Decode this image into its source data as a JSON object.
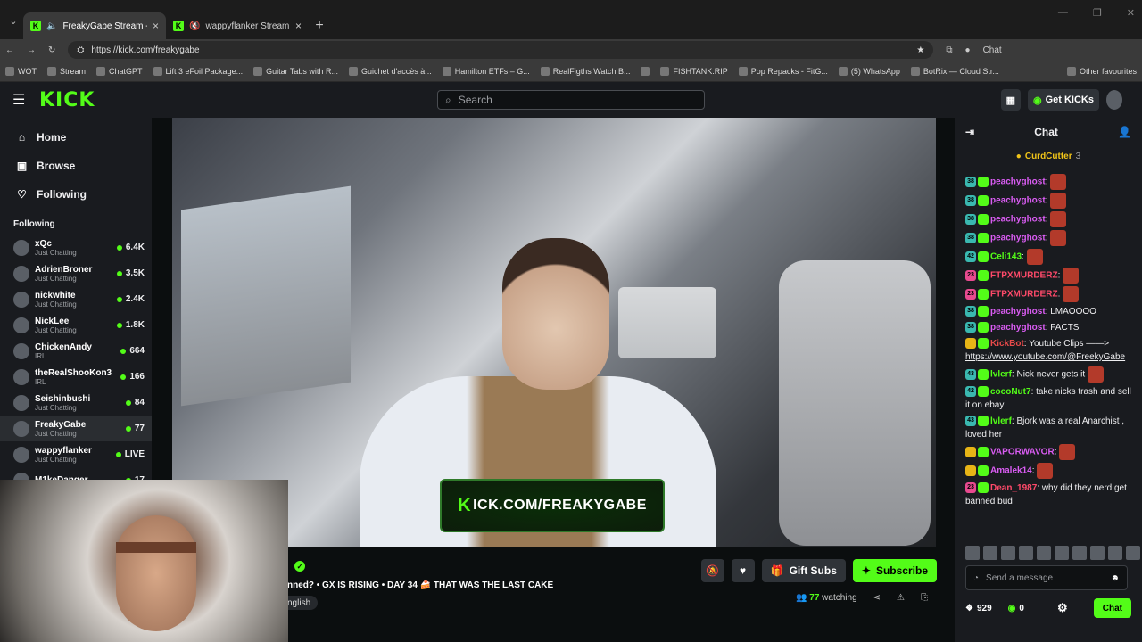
{
  "browser": {
    "tabs": [
      {
        "title": "FreakyGabe Stream - Watch L",
        "active": true
      },
      {
        "title": "wappyflanker Stream - Watc",
        "active": false
      }
    ],
    "new_tab": "+",
    "url": "https://kick.com/freakygabe",
    "chat_label": "Chat"
  },
  "bookmarks": [
    "WOT",
    "Stream",
    "ChatGPT",
    "Lift 3 eFoil Package...",
    "Guitar Tabs with R...",
    "Guichet d'accès à...",
    "Hamilton ETFs – G...",
    "RealFigths Watch B...",
    "FISHTANK.RIP",
    "Pop Repacks - FitG...",
    "(5) WhatsApp",
    "BotRix — Cloud Str...",
    "Other favourites"
  ],
  "header": {
    "logo": "KICK",
    "search_placeholder": "Search",
    "get_kicks": "Get KICKs"
  },
  "sidebar": {
    "nav": [
      {
        "label": "Home",
        "icon": "home-icon"
      },
      {
        "label": "Browse",
        "icon": "browse-icon"
      },
      {
        "label": "Following",
        "icon": "heart-icon"
      }
    ],
    "section_title": "Following",
    "channels": [
      {
        "name": "xQc",
        "desc": "Just Chatting",
        "count": "6.4K"
      },
      {
        "name": "AdrienBroner",
        "desc": "Just Chatting",
        "count": "3.5K"
      },
      {
        "name": "nickwhite",
        "desc": "Just Chatting",
        "count": "2.4K"
      },
      {
        "name": "NickLee",
        "desc": "Just Chatting",
        "count": "1.8K"
      },
      {
        "name": "ChickenAndy",
        "desc": "IRL",
        "count": "664"
      },
      {
        "name": "theRealShooKon3",
        "desc": "IRL",
        "count": "166"
      },
      {
        "name": "Seishinbushi",
        "desc": "Just Chatting",
        "count": "84"
      },
      {
        "name": "FreakyGabe",
        "desc": "Just Chatting",
        "count": "77"
      },
      {
        "name": "wappyflanker",
        "desc": "Just Chatting",
        "count": "LIVE"
      },
      {
        "name": "M1keDanger",
        "desc": "",
        "count": "17"
      }
    ]
  },
  "stream": {
    "watermark": "ICK.COM/FREAKYGABE",
    "watermark_k": "K",
    "title": "nned? • GX IS RISING • DAY 34 🍰 THAT WAS THE LAST CAKE",
    "language": "nglish",
    "gift_subs": "Gift Subs",
    "subscribe": "Subscribe",
    "watching_count": "77",
    "watching_label": "watching"
  },
  "chat": {
    "title": "Chat",
    "pinned_user": "CurdCutter",
    "pinned_count": "3",
    "messages": [
      {
        "badge": "38",
        "user": "peachyghost",
        "color": "#d95cf2",
        "text": "",
        "emote": true
      },
      {
        "badge": "38",
        "user": "peachyghost",
        "color": "#d95cf2",
        "text": "",
        "emote": true
      },
      {
        "badge": "38",
        "user": "peachyghost",
        "color": "#d95cf2",
        "text": "",
        "emote": true
      },
      {
        "badge": "38",
        "user": "peachyghost",
        "color": "#d95cf2",
        "text": "",
        "emote": true
      },
      {
        "badge": "42",
        "user": "Celi143",
        "color": "#53fc18",
        "text": "",
        "emote": true
      },
      {
        "badge": "23",
        "user": "FTPXMURDERZ",
        "color": "#ff4a6a",
        "text": "",
        "emote": true
      },
      {
        "badge": "23",
        "user": "FTPXMURDERZ",
        "color": "#ff4a6a",
        "text": "",
        "emote": true
      },
      {
        "badge": "38",
        "user": "peachyghost",
        "color": "#d95cf2",
        "text": "LMAOOOO",
        "emote": false
      },
      {
        "badge": "38",
        "user": "peachyghost",
        "color": "#d95cf2",
        "text": "FACTS",
        "emote": false
      },
      {
        "badge": "",
        "user": "KickBot",
        "color": "#e84a4a",
        "text": "Youtube Clips ——>",
        "link": "https://www.youtube.com/@FreekyGabe",
        "emote": false
      },
      {
        "badge": "43",
        "user": "lvlerf",
        "color": "#53fc18",
        "text": "Nick never gets it",
        "emote": true
      },
      {
        "badge": "42",
        "user": "cocoNut7",
        "color": "#53fc18",
        "text": "take nicks trash and sell it on ebay",
        "emote": false
      },
      {
        "badge": "43",
        "user": "lvlerf",
        "color": "#53fc18",
        "text": "Bjork was a real Anarchist , loved her",
        "emote": false
      },
      {
        "badge": "",
        "user": "VAPORWAVOR",
        "color": "#d95cf2",
        "text": "",
        "emote": true
      },
      {
        "badge": "",
        "user": "Amalek14",
        "color": "#d95cf2",
        "text": "",
        "emote": true
      },
      {
        "badge": "23",
        "user": "Dean_1987",
        "color": "#ff4a6a",
        "text": "why did they nerd get banned bud",
        "emote": false
      }
    ],
    "send_placeholder": "Send a message",
    "points": "929",
    "kicks": "0",
    "chat_button": "Chat"
  }
}
